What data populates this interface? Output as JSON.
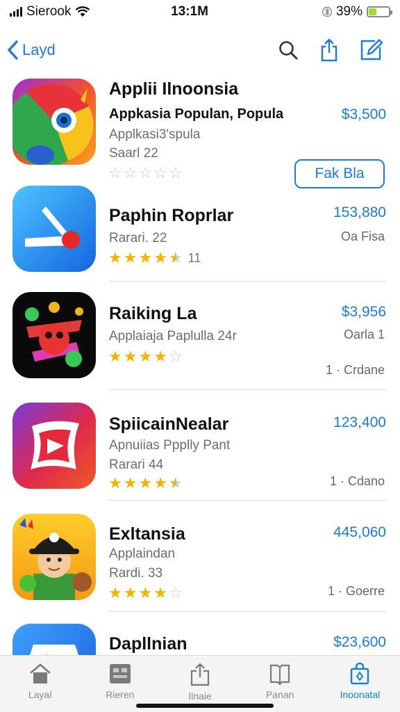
{
  "status": {
    "carrier": "Sierook",
    "time": "13:1M",
    "battery": "39%",
    "battery_level": 0.39
  },
  "nav": {
    "back_label": "Layd"
  },
  "apps": [
    {
      "title": "Applii Ilnoonsia",
      "subtitle": "Appkasia Populan, Popula",
      "category": "Applkasi3'spula",
      "rank": "Saarl 22",
      "price": "$3,500",
      "button": "Fak Bla",
      "stars": 0
    },
    {
      "title": "Paphin Roprlar",
      "rank": "Rarari. 22",
      "price": "153,880",
      "meta": "Oa Fisa",
      "stars": 4.5,
      "rating_count": "11"
    },
    {
      "title": "Raiking La",
      "category": "Applaiaja Paplulla 24r",
      "price": "$3,956",
      "meta_top": "Oarla 1",
      "meta": "1 · Crdane",
      "stars": 4
    },
    {
      "title": "SpiicainNealar",
      "category": "Apnuiias Ppplly Pant",
      "rank": "Rarari 44",
      "price": "123,400",
      "meta": "1 · Cdano",
      "stars": 4.5
    },
    {
      "title": "Exltansia",
      "category": "Applaindan",
      "rank": "Rardi. 33",
      "price": "445,060",
      "meta": "1 · Goerre",
      "stars": 4
    },
    {
      "title": "Dapllnian",
      "price": "$23,600"
    }
  ],
  "tabs": [
    {
      "label": "Layal",
      "icon": "home-icon"
    },
    {
      "label": "Rieren",
      "icon": "grid-icon"
    },
    {
      "label": "Ilnaie",
      "icon": "share-box-icon"
    },
    {
      "label": "Panan",
      "icon": "book-icon"
    },
    {
      "label": "Inoonatal",
      "icon": "bag-icon",
      "active": true
    }
  ],
  "colors": {
    "accent": "#1a7be0",
    "star": "#f5b301",
    "battery": "#9be02b"
  }
}
